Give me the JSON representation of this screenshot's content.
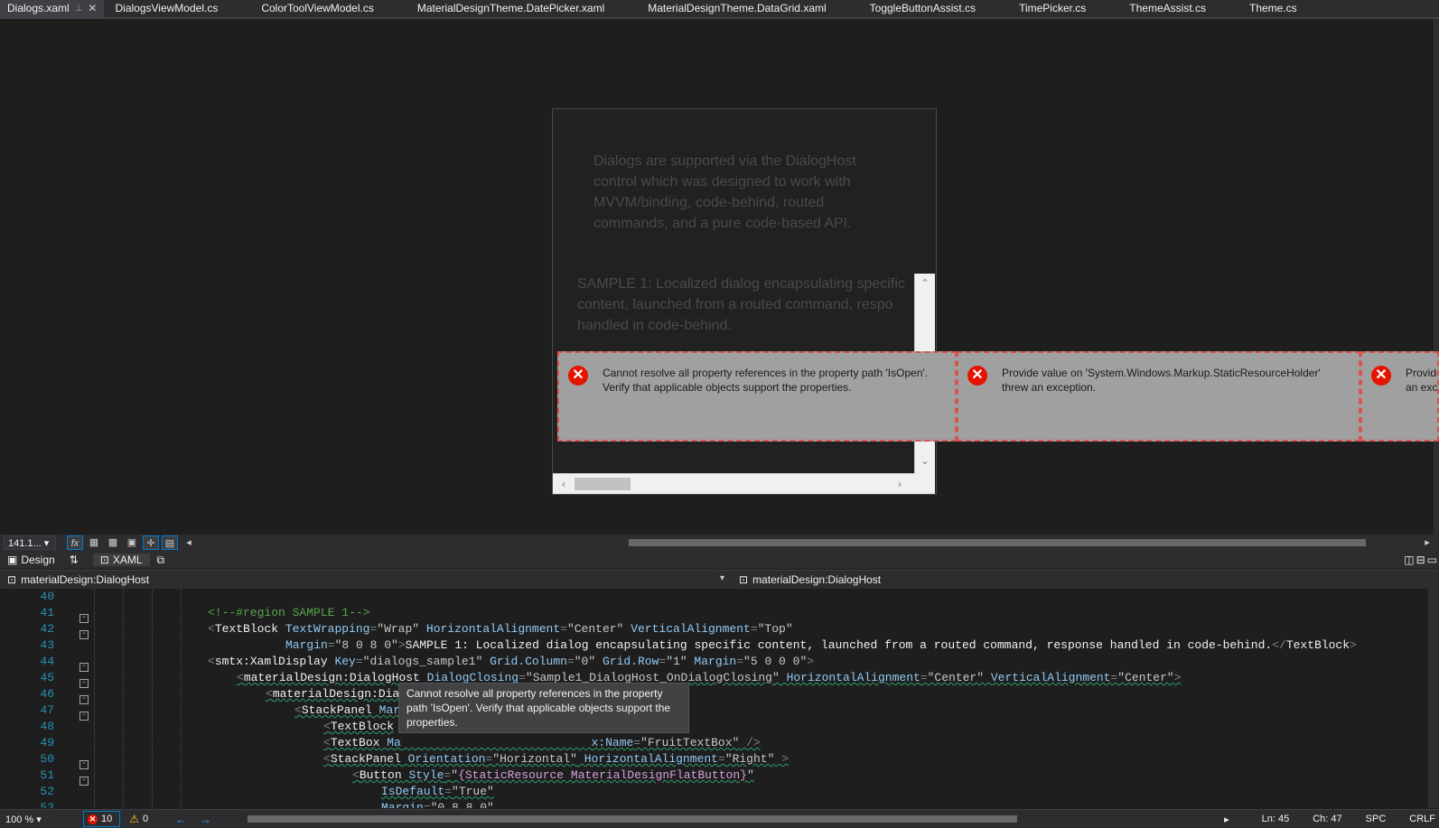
{
  "tabs": [
    {
      "label": "Dialogs.xaml",
      "active": true
    },
    {
      "label": "DialogsViewModel.cs"
    },
    {
      "label": "ColorToolViewModel.cs"
    },
    {
      "label": "MaterialDesignTheme.DatePicker.xaml"
    },
    {
      "label": "MaterialDesignTheme.DataGrid.xaml"
    },
    {
      "label": "ToggleButtonAssist.cs"
    },
    {
      "label": "TimePicker.cs"
    },
    {
      "label": "ThemeAssist.cs"
    },
    {
      "label": "Theme.cs"
    }
  ],
  "design": {
    "paragraph": "Dialogs are supported via the DialogHost control which was designed to work with MVVM/binding, code-behind, routed commands, and a pure code-based API.",
    "sample_line1": "SAMPLE 1: Localized dialog encapsulating specific",
    "sample_line2": "content, launched from a routed command, respo",
    "sample_line3": "handled in code-behind."
  },
  "errors": [
    {
      "message": "Cannot resolve all property references in the property path 'IsOpen'. Verify that applicable objects support the properties."
    },
    {
      "message": "Provide value on 'System.Windows.Markup.StaticResourceHolder' threw an exception."
    },
    {
      "message": "Provide value on 'System.Windows.Markup.StaticResourceHolder' threw an exception."
    }
  ],
  "design_toolbar": {
    "zoom": "141.1..."
  },
  "split": {
    "design_label": "Design",
    "xaml_label": "XAML"
  },
  "nav": {
    "left": "materialDesign:DialogHost",
    "right": "materialDesign:DialogHost"
  },
  "code": {
    "line_numbers": [
      "40",
      "41",
      "42",
      "43",
      "44",
      "45",
      "46",
      "47",
      "48",
      "49",
      "50",
      "51",
      "52",
      "53"
    ]
  },
  "tooltip": "Cannot resolve all property references in the property path 'IsOpen'. Verify that applicable objects support the properties.",
  "status": {
    "zoom": "100 %",
    "errors": "10",
    "warnings": "0",
    "ln": "Ln: 45",
    "ch": "Ch: 47",
    "spc": "SPC",
    "eol": "CRLF"
  }
}
